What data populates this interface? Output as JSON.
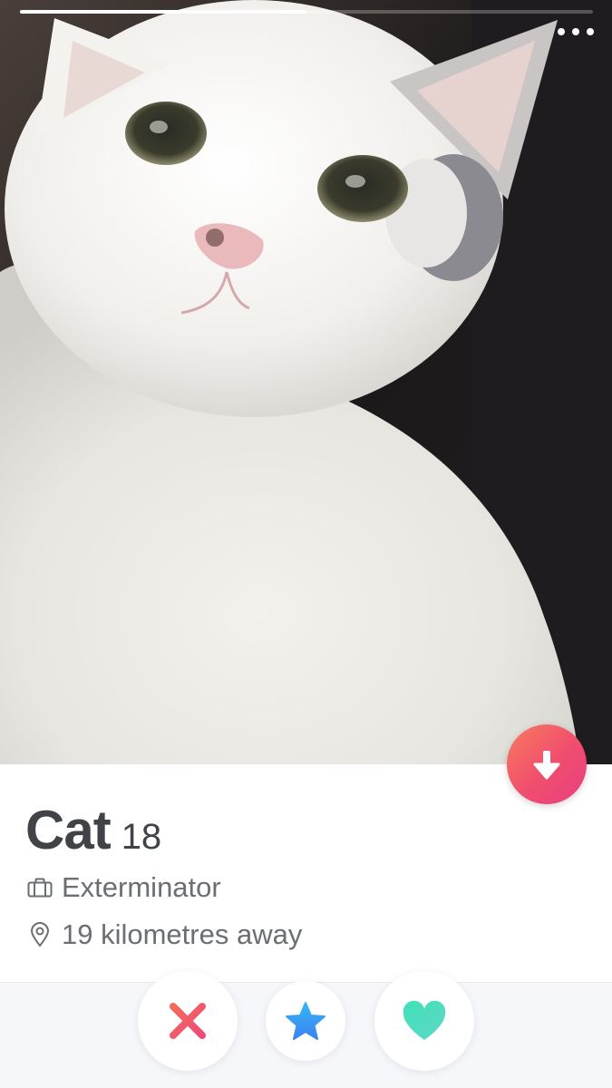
{
  "profile": {
    "name": "Cat",
    "age": "18",
    "job": "Exterminator",
    "distance": "19 kilometres away",
    "photo_subject": "white-and-grey-cat-photo"
  },
  "photo_progress": {
    "photo_count": 2,
    "current_photo": 1
  },
  "icons": {
    "more": "more-horizontal-icon",
    "info": "arrow-down-icon",
    "job": "briefcase-icon",
    "location": "location-pin-icon",
    "nope": "x-icon",
    "super_like": "star-icon",
    "like": "heart-icon"
  },
  "colors": {
    "info_gradient_start": "#f87a5b",
    "info_gradient_end": "#e8407f",
    "nope": "#f0556a",
    "super_like": "#3ba0f5",
    "like": "#4ee0ba",
    "name_text": "#404347",
    "detail_text": "#6b6e73"
  }
}
